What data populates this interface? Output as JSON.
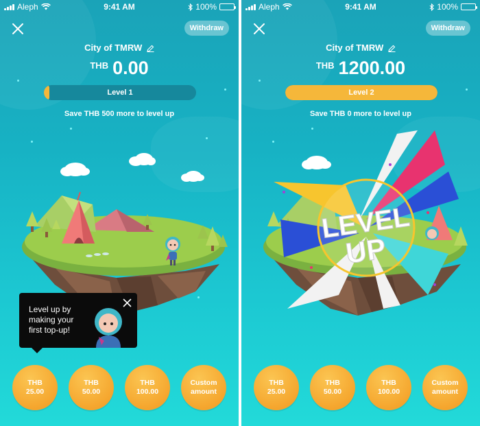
{
  "colors": {
    "accent_orange": "#f5b73a",
    "button_orange": "#f5a62e",
    "bg_teal_top": "#1aa3b8",
    "bg_teal_bottom": "#22dad9",
    "bar_track": "#16889c",
    "tooltip_bg": "#0b0b0b"
  },
  "screens": [
    {
      "status": {
        "carrier": "Aleph",
        "time": "9:41 AM",
        "battery": "100%"
      },
      "close_icon": "close-icon",
      "withdraw_label": "Withdraw",
      "city_name": "City of TMRW",
      "edit_icon": "pencil-icon",
      "currency": "THB",
      "balance": "0.00",
      "level": {
        "label": "Level 1",
        "progress": 0.02
      },
      "level_up_msg": "Save THB 500 more to level up",
      "tooltip": {
        "text": "Level up by making your first top-up!",
        "close_icon": "close-icon"
      },
      "amount_buttons": [
        {
          "line1": "THB",
          "line2": "25.00"
        },
        {
          "line1": "THB",
          "line2": "50.00"
        },
        {
          "line1": "THB",
          "line2": "100.00"
        },
        {
          "line1": "Custom",
          "line2": "amount"
        }
      ]
    },
    {
      "status": {
        "carrier": "Aleph",
        "time": "9:41 AM",
        "battery": "100%"
      },
      "close_icon": "close-icon",
      "withdraw_label": "Withdraw",
      "city_name": "City of TMRW",
      "edit_icon": "pencil-icon",
      "currency": "THB",
      "balance": "1200.00",
      "level": {
        "label": "Level 2",
        "progress": 1.0
      },
      "level_up_msg": "Save THB 0 more to level up",
      "level_up_banner": {
        "line1": "LEVEL",
        "line2": "UP"
      },
      "amount_buttons": [
        {
          "line1": "THB",
          "line2": "25.00"
        },
        {
          "line1": "THB",
          "line2": "50.00"
        },
        {
          "line1": "THB",
          "line2": "100.00"
        },
        {
          "line1": "Custom",
          "line2": "amount"
        }
      ]
    }
  ]
}
